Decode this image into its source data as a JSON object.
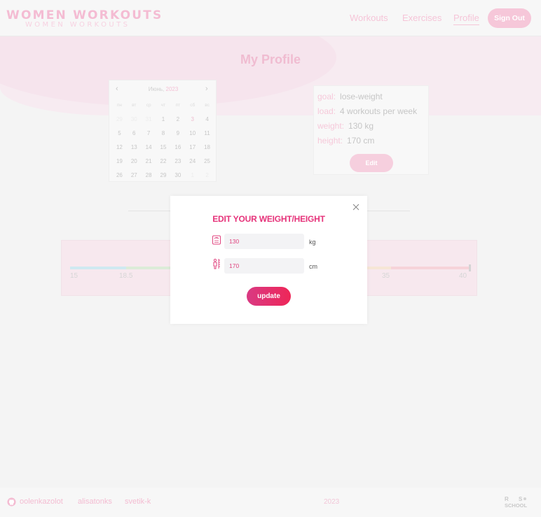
{
  "header": {
    "logo_main": "WOMEN WORKOUTS",
    "logo_sub": "WOMEN WORKOUTS",
    "nav": [
      {
        "label": "Workouts"
      },
      {
        "label": "Exercises"
      },
      {
        "label": "Profile",
        "active": true
      }
    ],
    "sign_out_label": "Sign Out"
  },
  "page_title": "My Profile",
  "calendar": {
    "month": "Июнь",
    "year": "2023",
    "weekdays": [
      "пн",
      "вт",
      "ср",
      "чт",
      "пт",
      "сб",
      "вс"
    ],
    "days": [
      "29",
      "30",
      "31",
      "1",
      "2",
      "3",
      "4",
      "5",
      "6",
      "7",
      "8",
      "9",
      "10",
      "11",
      "12",
      "13",
      "14",
      "15",
      "16",
      "17",
      "18",
      "19",
      "20",
      "21",
      "22",
      "23",
      "24",
      "25",
      "26",
      "27",
      "28",
      "29",
      "30",
      "1",
      "2"
    ]
  },
  "profile": {
    "goal_label": "goal:",
    "goal_value": "lose-weight",
    "load_label": "load:",
    "load_value": "4 workouts per week",
    "weight_label": "weight:",
    "weight_value": "130 kg",
    "height_label": "height:",
    "height_value": "170 cm",
    "edit_label": "Edit"
  },
  "bmi_scale": {
    "ticks": [
      "15",
      "18.5",
      "35",
      "40"
    ]
  },
  "modal": {
    "title": "EDIT YOUR WEIGHT/HEIGHT",
    "weight_value": "130",
    "weight_unit": "kg",
    "height_value": "170",
    "height_unit": "cm",
    "update_label": "update"
  },
  "footer": {
    "authors": [
      "oolenkazolot",
      "alisatonks",
      "svetik-k"
    ],
    "year": "2023"
  },
  "colors": {
    "accent": "#e6337a",
    "brand_pink": "#f4bcd3",
    "button_gradient_start": "#d93a83",
    "button_gradient_end": "#ee2658"
  }
}
